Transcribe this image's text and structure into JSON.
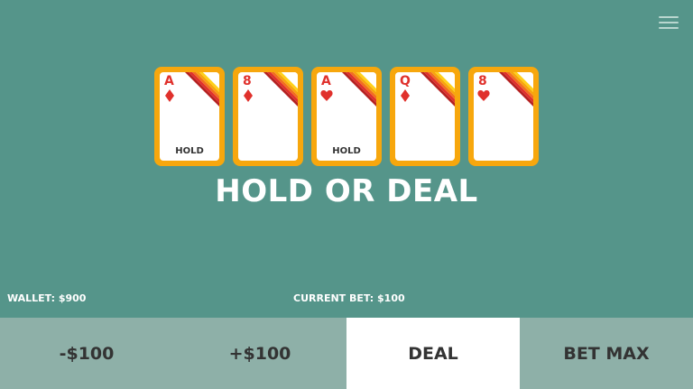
{
  "cards": [
    {
      "rank": "A",
      "suit": "diamond",
      "hold": "HOLD"
    },
    {
      "rank": "8",
      "suit": "diamond",
      "hold": ""
    },
    {
      "rank": "A",
      "suit": "heart",
      "hold": "HOLD"
    },
    {
      "rank": "Q",
      "suit": "diamond",
      "hold": ""
    },
    {
      "rank": "8",
      "suit": "heart",
      "hold": ""
    }
  ],
  "headline": "HOLD OR DEAL",
  "wallet": "WALLET: $900",
  "current_bet": "CURRENT BET: $100",
  "buttons": {
    "minus": "-$100",
    "plus": "+$100",
    "deal": "DEAL",
    "bet_max": "BET MAX"
  },
  "colors": {
    "background": "#55958a",
    "card_border": "#f7a70d",
    "suit_red": "#e0312c",
    "button": "#8eb0a8",
    "deal_button": "#ffffff"
  },
  "icons": {
    "menu": "hamburger-menu-icon"
  }
}
